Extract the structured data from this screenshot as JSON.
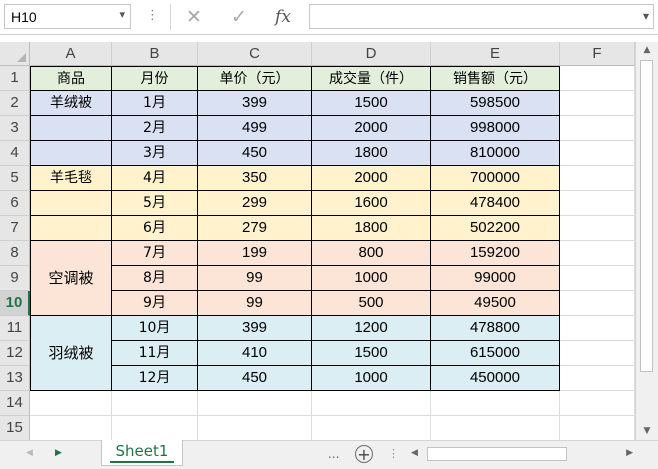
{
  "formula_bar": {
    "name_box": "H10",
    "cancel_glyph": "✕",
    "enter_glyph": "✓",
    "fx_label": "fx",
    "formula": ""
  },
  "columns": [
    "A",
    "B",
    "C",
    "D",
    "E",
    "F"
  ],
  "rows": [
    "1",
    "2",
    "3",
    "4",
    "5",
    "6",
    "7",
    "8",
    "9",
    "10",
    "11",
    "12",
    "13",
    "14",
    "15"
  ],
  "selected_row": "10",
  "table": {
    "headers": [
      "商品",
      "月份",
      "单价（元）",
      "成交量（件）",
      "销售额（元）"
    ],
    "groups": [
      {
        "product": "羊绒被",
        "color": "#d9e1f2"
      },
      {
        "product": "羊毛毯",
        "color": "#fff2cc"
      },
      {
        "product": "空调被",
        "color": "#fce4d6"
      },
      {
        "product": "羽绒被",
        "color": "#daeef3"
      }
    ],
    "data": [
      [
        "1月",
        "399",
        "1500",
        "598500"
      ],
      [
        "2月",
        "499",
        "2000",
        "998000"
      ],
      [
        "3月",
        "450",
        "1800",
        "810000"
      ],
      [
        "4月",
        "350",
        "2000",
        "700000"
      ],
      [
        "5月",
        "299",
        "1600",
        "478400"
      ],
      [
        "6月",
        "279",
        "1800",
        "502200"
      ],
      [
        "7月",
        "199",
        "800",
        "159200"
      ],
      [
        "8月",
        "99",
        "1000",
        "99000"
      ],
      [
        "9月",
        "99",
        "500",
        "49500"
      ],
      [
        "10月",
        "399",
        "1200",
        "478800"
      ],
      [
        "11月",
        "410",
        "1500",
        "615000"
      ],
      [
        "12月",
        "450",
        "1000",
        "450000"
      ]
    ]
  },
  "sheet_tab": "Sheet1",
  "tab_ellipsis": "...",
  "add_sheet_glyph": "+"
}
